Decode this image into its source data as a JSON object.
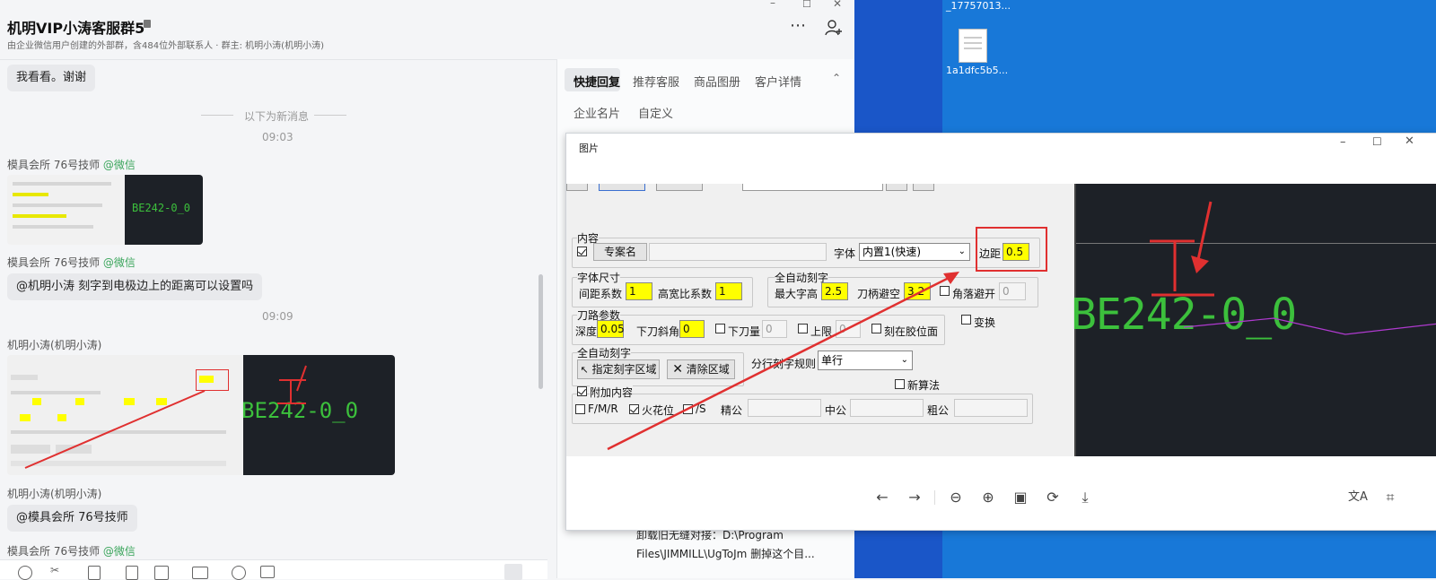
{
  "chat": {
    "title": "机明VIP小涛客服群5",
    "subtitle": "由企业微信用户创建的外部群，含484位外部联系人 · 群主: 机明小涛(机明小涛)",
    "messages": {
      "m1": "我看看。谢谢",
      "new_divider": "以下为新消息",
      "t1": "09:03",
      "s1_name": "模具会所 76号技师",
      "s1_src": "@微信",
      "s2_name": "模具会所 76号技师",
      "s2_src": "@微信",
      "m2": "@机明小涛  刻字到电极边上的距离可以设置吗",
      "t2": "09:09",
      "s3_name": "机明小涛(机明小涛)",
      "s4_name": "机明小涛(机明小涛)",
      "m3": "@模具会所 76号技师",
      "s5_name": "模具会所 76号技师",
      "s5_src": "@微信"
    },
    "thumb_small_text": "BE242-0_0",
    "thumb_large_text": "BE242-0_0"
  },
  "panel": {
    "tabs": [
      "快捷回复",
      "推荐客服",
      "商品图册",
      "客户详情"
    ],
    "tabs2": [
      "企业名片",
      "自定义"
    ],
    "snippet_line1": "卸载旧无缝对接：D:\\Program",
    "snippet_line2": "Files\\JIMMILL\\UgToJm  删掉这个目..."
  },
  "desktop": {
    "file1_label": "_17757013...",
    "file2_label": "1a1dfc5b5..."
  },
  "viewer": {
    "title": "图片",
    "form": {
      "content_group": "内容",
      "btn_template": "专案名",
      "font_label": "字体",
      "font_value": "内置1(快速)",
      "margin_label": "边距",
      "margin_value": "0.5",
      "size_group": "字体尺寸",
      "spacing_label": "间距系数",
      "spacing_value": "1",
      "ratio_label": "高宽比系数",
      "ratio_value": "1",
      "auto_group": "全自动刻字",
      "max_height_label": "最大字高",
      "max_height_value": "2.5",
      "shank_label": "刀柄避空",
      "shank_value": "3.2",
      "corner_label": "角落避开",
      "corner_value": "0",
      "path_group": "刀路参数",
      "depth_label": "深度",
      "depth_value": "0.05",
      "bevel_label": "下刀斜角",
      "bevel_value": "0",
      "feed_label": "下刀量",
      "feed_value": "0",
      "upper_label": "上限",
      "upper_value": "0",
      "glue_label": "刻在胶位面",
      "transform_label": "变换",
      "auto2_group": "全自动刻字",
      "btn_specify": "指定刻字区域",
      "btn_clear": "清除区域",
      "split_label": "分行刻字规则",
      "split_value": "单行",
      "new_algo_label": "新算法",
      "extra_label": "附加内容",
      "fmr_label": "F/M/R",
      "spark_label": "火花位",
      "s_label": "/S",
      "fine_label": "精公",
      "mid_label": "中公",
      "rough_label": "粗公"
    },
    "preview_text": "BE242-0_0"
  }
}
